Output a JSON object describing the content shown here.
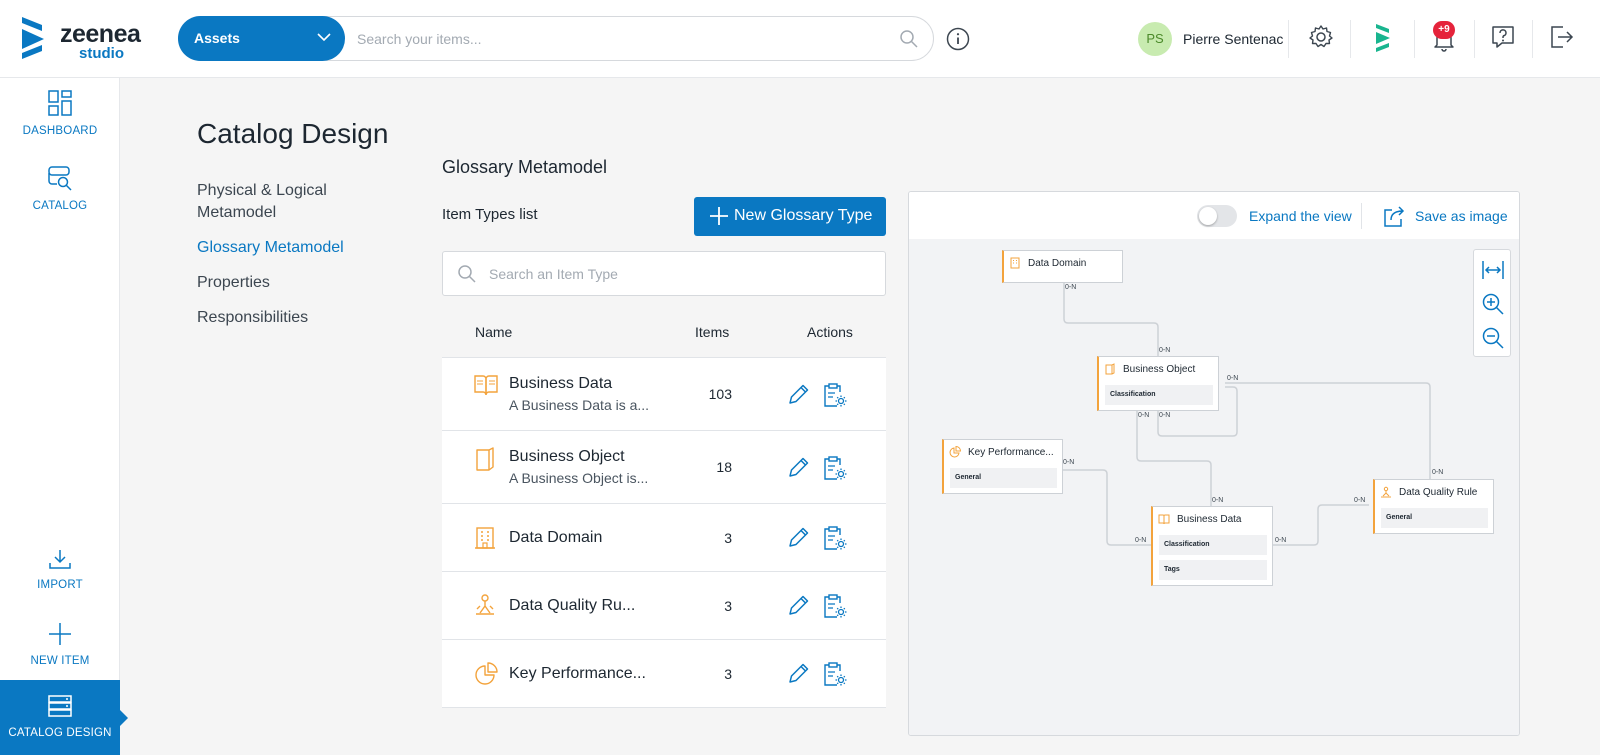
{
  "app": {
    "logo_word": "zeenea",
    "logo_sub": "studio",
    "brand_color": "#0a78c2",
    "accent_orange": "#f3a33c"
  },
  "topbar": {
    "scope_label": "Assets",
    "search_placeholder": "Search your items...",
    "user_initials": "PS",
    "user_name": "Pierre Sentenac",
    "notif_badge": "+9"
  },
  "leftnav": {
    "dashboard": "DASHBOARD",
    "catalog": "CATALOG",
    "import": "IMPORT",
    "new_item": "NEW ITEM",
    "catalog_design": "CATALOG DESIGN"
  },
  "page": {
    "title": "Catalog Design",
    "subnav": [
      {
        "label": "Physical & Logical Metamodel"
      },
      {
        "label": "Glossary Metamodel"
      },
      {
        "label": "Properties"
      },
      {
        "label": "Responsibilities"
      }
    ]
  },
  "glossary": {
    "section_title": "Glossary Metamodel",
    "list_title": "Item Types list",
    "new_button": "New Glossary Type",
    "search_placeholder": "Search an Item Type",
    "columns": {
      "name": "Name",
      "items": "Items",
      "actions": "Actions"
    },
    "rows": [
      {
        "name": "Business Data",
        "desc": "A Business Data is a...",
        "count": "103",
        "icon": "book-icon"
      },
      {
        "name": "Business Object",
        "desc": "A Business Object is...",
        "count": "18",
        "icon": "object-icon"
      },
      {
        "name": "Data Domain",
        "desc": "",
        "count": "3",
        "icon": "building-icon"
      },
      {
        "name": "Data Quality Ru...",
        "desc": "",
        "count": "3",
        "icon": "quality-icon"
      },
      {
        "name": "Key Performance...",
        "desc": "",
        "count": "3",
        "icon": "pie-chart-icon"
      }
    ]
  },
  "diagram": {
    "expand_label": "Expand the view",
    "save_label": "Save as image",
    "nodes": {
      "data_domain": {
        "title": "Data Domain"
      },
      "business_object": {
        "title": "Business Object",
        "sections": [
          "Classification"
        ]
      },
      "kpi": {
        "title": "Key Performance...",
        "sections": [
          "General"
        ]
      },
      "business_data": {
        "title": "Business Data",
        "sections": [
          "Classification",
          "Tags"
        ]
      },
      "dq_rule": {
        "title": "Data Quality Rule",
        "sections": [
          "General"
        ]
      }
    },
    "cardinality": "0-N"
  }
}
